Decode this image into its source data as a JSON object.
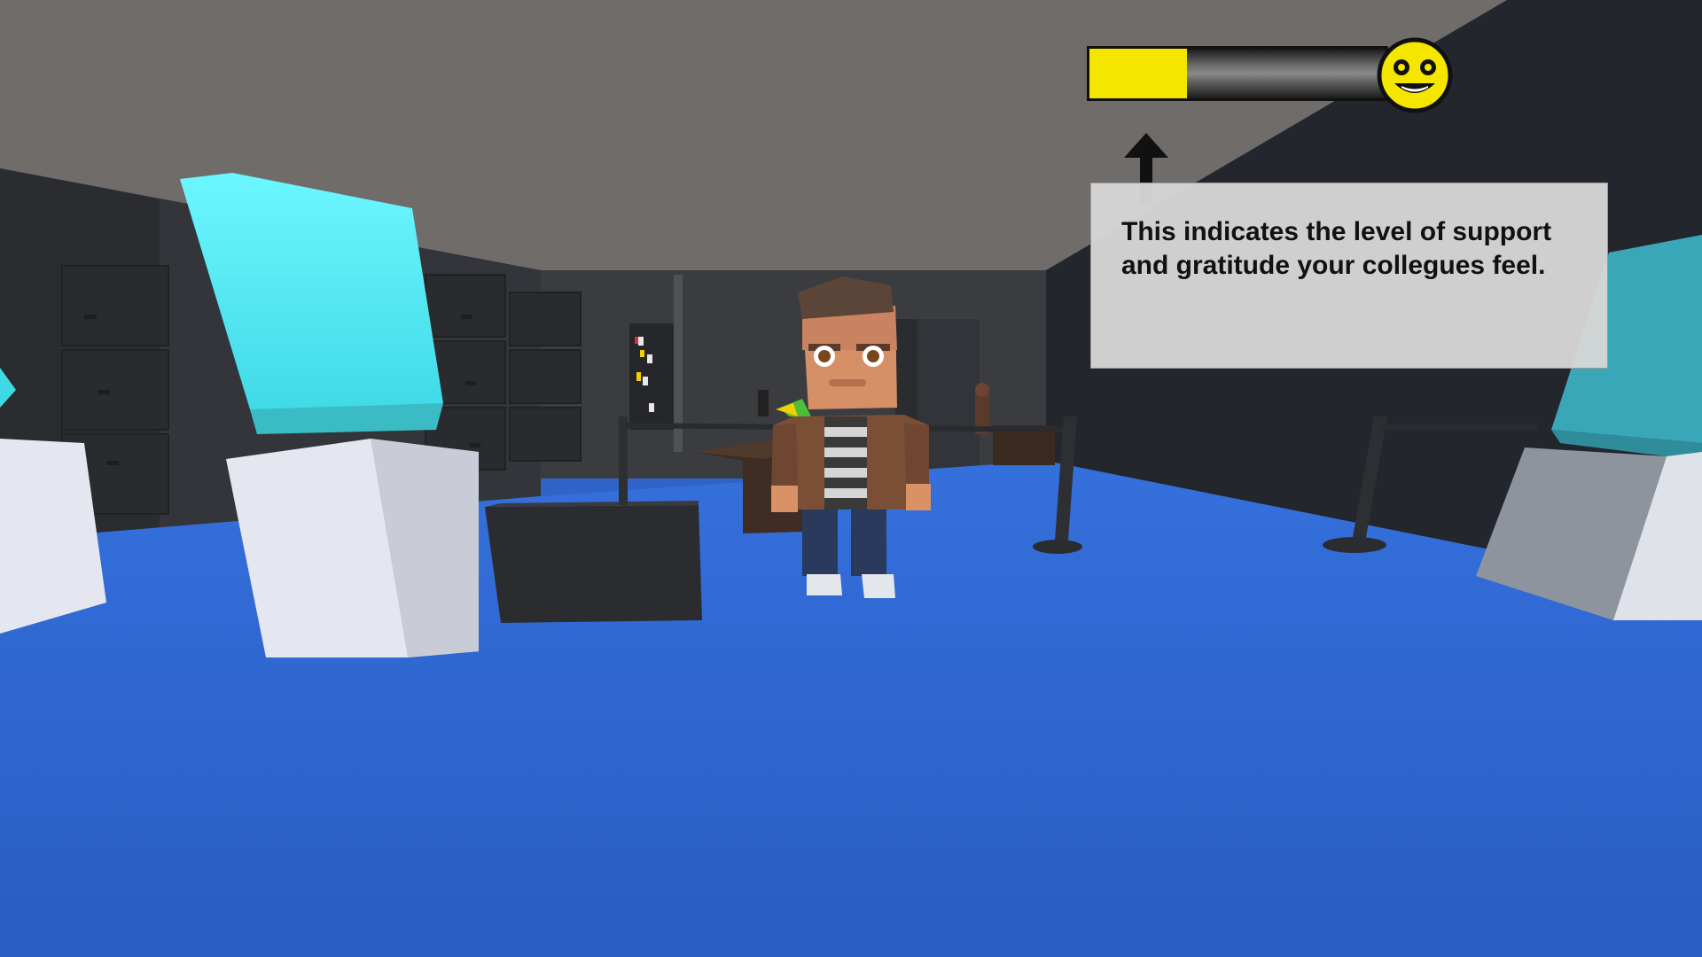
{
  "hud": {
    "support_level": 0.33,
    "bar_fill_color": "#f5e600",
    "mood_icon": "smiley-face-icon",
    "arrow_icon": "arrow-up-icon"
  },
  "tutorial": {
    "text": "This indicates the level of support and gratitude your collegues feel."
  },
  "scene": {
    "floor_color": "#2f63c8",
    "ceiling_color": "#6f6c6a",
    "wall_color": "#3a3b3f",
    "screen_color": "#52e8f2",
    "pedestal_color": "#e3e6ee"
  }
}
